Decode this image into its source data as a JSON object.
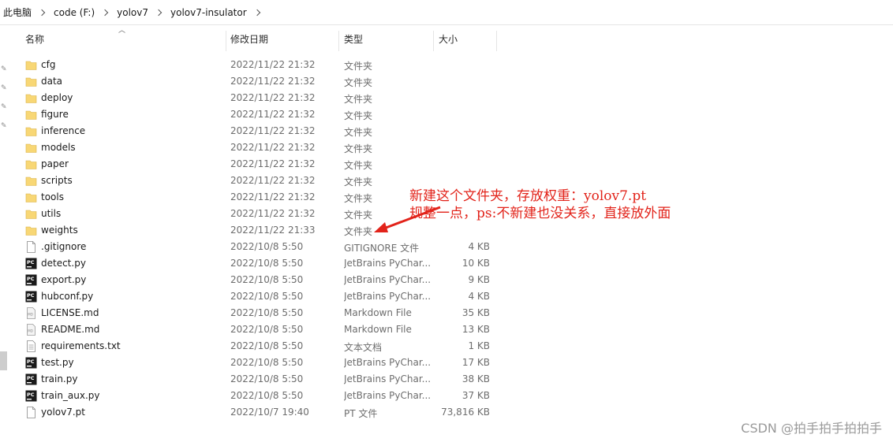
{
  "breadcrumb": [
    "此电脑",
    "code (F:)",
    "yolov7",
    "yolov7-insulator"
  ],
  "columns": {
    "name": "名称",
    "date": "修改日期",
    "type": "类型",
    "size": "大小"
  },
  "files": [
    {
      "name": "cfg",
      "date": "2022/11/22 21:32",
      "type": "文件夹",
      "size": "",
      "icon": "folder-icon"
    },
    {
      "name": "data",
      "date": "2022/11/22 21:32",
      "type": "文件夹",
      "size": "",
      "icon": "folder-icon"
    },
    {
      "name": "deploy",
      "date": "2022/11/22 21:32",
      "type": "文件夹",
      "size": "",
      "icon": "folder-icon"
    },
    {
      "name": "figure",
      "date": "2022/11/22 21:32",
      "type": "文件夹",
      "size": "",
      "icon": "folder-icon"
    },
    {
      "name": "inference",
      "date": "2022/11/22 21:32",
      "type": "文件夹",
      "size": "",
      "icon": "folder-icon"
    },
    {
      "name": "models",
      "date": "2022/11/22 21:32",
      "type": "文件夹",
      "size": "",
      "icon": "folder-icon"
    },
    {
      "name": "paper",
      "date": "2022/11/22 21:32",
      "type": "文件夹",
      "size": "",
      "icon": "folder-icon"
    },
    {
      "name": "scripts",
      "date": "2022/11/22 21:32",
      "type": "文件夹",
      "size": "",
      "icon": "folder-icon"
    },
    {
      "name": "tools",
      "date": "2022/11/22 21:32",
      "type": "文件夹",
      "size": "",
      "icon": "folder-icon"
    },
    {
      "name": "utils",
      "date": "2022/11/22 21:32",
      "type": "文件夹",
      "size": "",
      "icon": "folder-icon"
    },
    {
      "name": "weights",
      "date": "2022/11/22 21:33",
      "type": "文件夹",
      "size": "",
      "icon": "folder-icon"
    },
    {
      "name": ".gitignore",
      "date": "2022/10/8 5:50",
      "type": "GITIGNORE 文件",
      "size": "4 KB",
      "icon": "file-icon"
    },
    {
      "name": "detect.py",
      "date": "2022/10/8 5:50",
      "type": "JetBrains PyChar...",
      "size": "10 KB",
      "icon": "pycharm-icon"
    },
    {
      "name": "export.py",
      "date": "2022/10/8 5:50",
      "type": "JetBrains PyChar...",
      "size": "9 KB",
      "icon": "pycharm-icon"
    },
    {
      "name": "hubconf.py",
      "date": "2022/10/8 5:50",
      "type": "JetBrains PyChar...",
      "size": "4 KB",
      "icon": "pycharm-icon"
    },
    {
      "name": "LICENSE.md",
      "date": "2022/10/8 5:50",
      "type": "Markdown File",
      "size": "35 KB",
      "icon": "markdown-file-icon"
    },
    {
      "name": "README.md",
      "date": "2022/10/8 5:50",
      "type": "Markdown File",
      "size": "13 KB",
      "icon": "markdown-file-icon"
    },
    {
      "name": "requirements.txt",
      "date": "2022/10/8 5:50",
      "type": "文本文档",
      "size": "1 KB",
      "icon": "text-file-icon"
    },
    {
      "name": "test.py",
      "date": "2022/10/8 5:50",
      "type": "JetBrains PyChar...",
      "size": "17 KB",
      "icon": "pycharm-icon"
    },
    {
      "name": "train.py",
      "date": "2022/10/8 5:50",
      "type": "JetBrains PyChar...",
      "size": "38 KB",
      "icon": "pycharm-icon"
    },
    {
      "name": "train_aux.py",
      "date": "2022/10/8 5:50",
      "type": "JetBrains PyChar...",
      "size": "37 KB",
      "icon": "pycharm-icon"
    },
    {
      "name": "yolov7.pt",
      "date": "2022/10/7 19:40",
      "type": "PT 文件",
      "size": "73,816 KB",
      "icon": "file-icon"
    }
  ],
  "annotation": {
    "line1": "新建这个文件夹，存放权重：yolov7.pt",
    "line2": "规整一点，ps:不新建也没关系，直接放外面",
    "color": "#e2231a"
  },
  "watermark": "CSDN @拍手拍手拍拍手",
  "colors": {
    "folder": "#f8d775",
    "pycharm": "#1a1a1a",
    "pycharm_bar": "#21d789"
  }
}
